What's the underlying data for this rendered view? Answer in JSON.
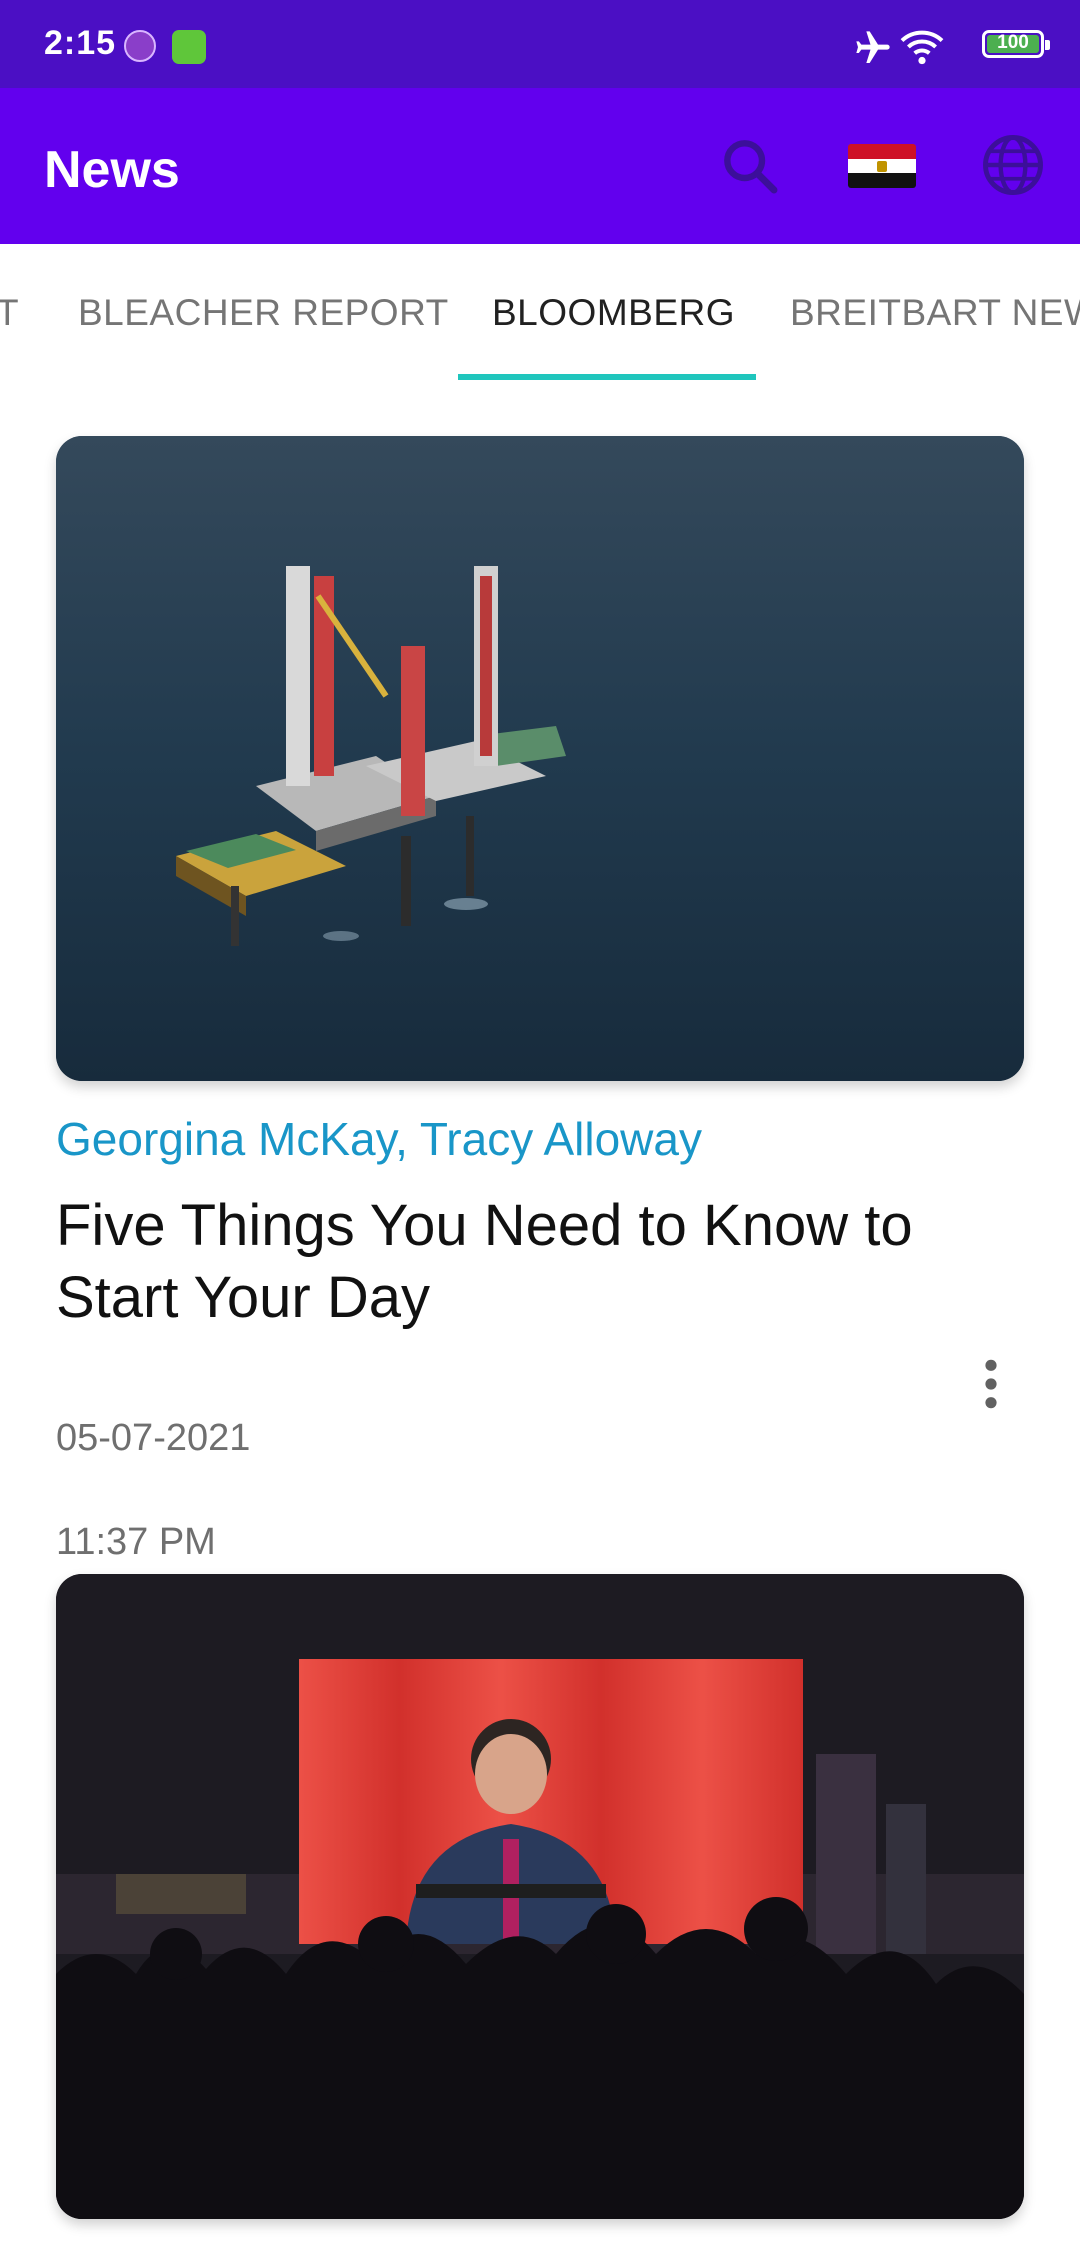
{
  "status_bar": {
    "time": "2:15",
    "battery": "100",
    "icons": [
      "app-icon-s",
      "app-icon-android",
      "airplane-icon",
      "wifi-icon",
      "battery-icon"
    ]
  },
  "app_bar": {
    "title": "News",
    "actions": [
      "search-icon",
      "flag-icon",
      "globe-icon"
    ]
  },
  "tabs": {
    "items": [
      {
        "label": "T"
      },
      {
        "label": "BLEACHER REPORT"
      },
      {
        "label": "BLOOMBERG",
        "active": true
      },
      {
        "label": "BREITBART NEWS"
      }
    ],
    "accent_color": "#1fc6bd"
  },
  "articles": [
    {
      "author": "Georgina McKay, Tracy Alloway",
      "title": "Five Things You Need to Know to Start Your Day",
      "date": "05-07-2021",
      "time": "11:37 PM",
      "image": "offshore-oil-rig-photo"
    },
    {
      "image": "crowd-watching-screen-photo"
    }
  ],
  "colors": {
    "status_bar": "#4b0fc4",
    "app_bar": "#6200ee",
    "author": "#1996c8"
  }
}
